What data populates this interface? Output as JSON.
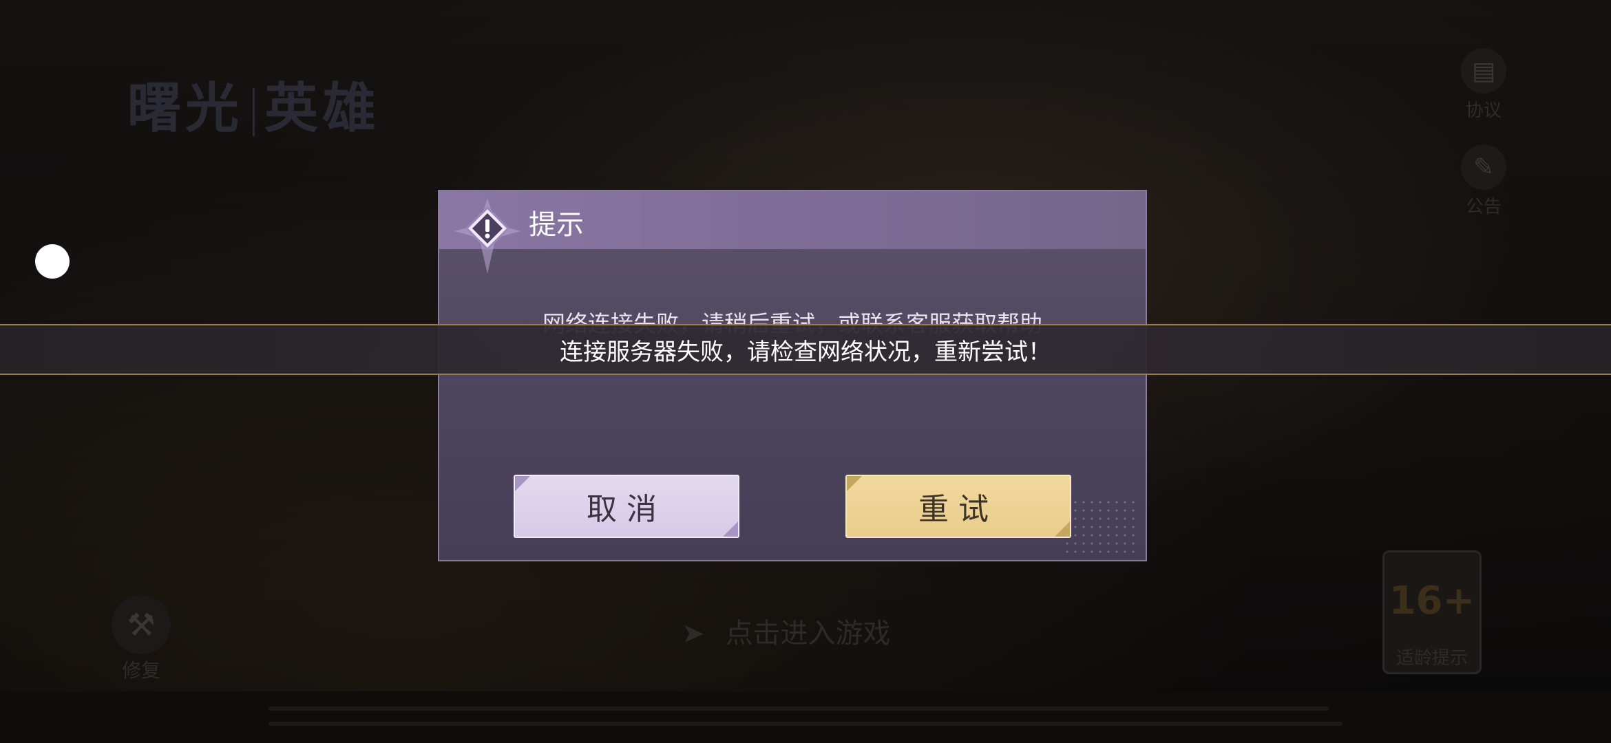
{
  "background": {
    "logo_left": "曙光",
    "logo_right": "英雄",
    "agreement_label": "协议",
    "notice_label": "公告",
    "repair_label": "修复",
    "enter_game_label": "点击进入游戏",
    "age_rating_number": "16+",
    "age_rating_label": "适龄提示"
  },
  "dialog": {
    "title": "提示",
    "message": "网络连接失败，请稍后重试，或联系客服获取帮助",
    "cancel_label": "取消",
    "retry_label": "重试"
  },
  "toast": {
    "message": "连接服务器失败，请检查网络状况，重新尝试！"
  },
  "icons": {
    "warning": "warning-icon",
    "agreement": "document-icon",
    "notice": "megaphone-icon",
    "repair": "wrench-icon",
    "enter_arrow": "chevron-right-icon"
  },
  "colors": {
    "dialog_header": "#8a77a4",
    "dialog_body": "#4f4660",
    "cancel_button": "#ddd1eb",
    "retry_button": "#eed396",
    "toast_border": "#9c7d4a"
  }
}
